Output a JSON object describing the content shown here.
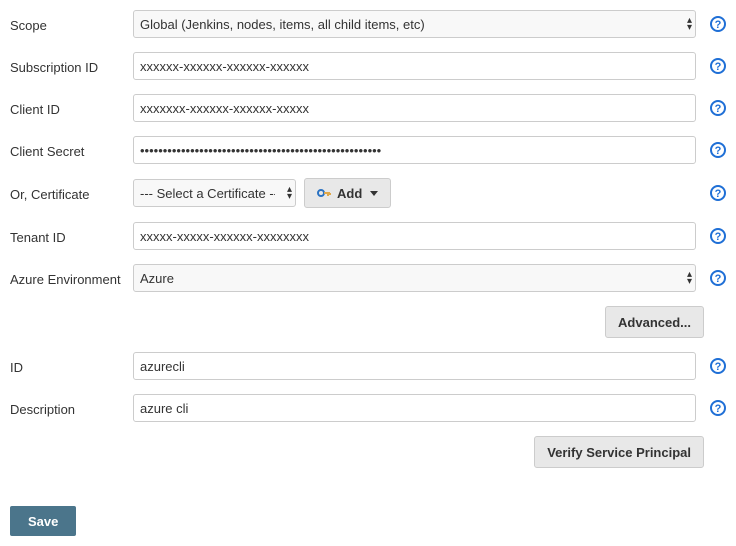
{
  "fields": {
    "scope": {
      "label": "Scope",
      "value": "Global (Jenkins, nodes, items, all child items, etc)"
    },
    "subscriptionId": {
      "label": "Subscription ID",
      "value": "xxxxxx-xxxxxx-xxxxxx-xxxxxx"
    },
    "clientId": {
      "label": "Client ID",
      "value": "xxxxxxx-xxxxxx-xxxxxx-xxxxx"
    },
    "clientSecret": {
      "label": "Client Secret",
      "value": "•••••••••••••••••••••••••••••••••••••••••••••••••••••"
    },
    "certificate": {
      "label": "Or, Certificate",
      "value": "--- Select a Certificate ---",
      "addLabel": "Add"
    },
    "tenantId": {
      "label": "Tenant ID",
      "value": "xxxxx-xxxxx-xxxxxx-xxxxxxxx"
    },
    "azureEnv": {
      "label": "Azure Environment",
      "value": "Azure"
    },
    "id": {
      "label": "ID",
      "value": "azurecli"
    },
    "description": {
      "label": "Description",
      "value": "azure cli"
    }
  },
  "buttons": {
    "advanced": "Advanced...",
    "verify": "Verify Service Principal",
    "save": "Save"
  }
}
